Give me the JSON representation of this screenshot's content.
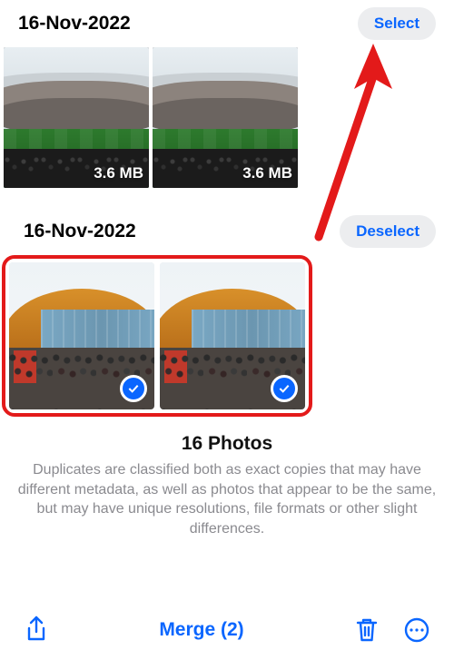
{
  "groups": [
    {
      "date": "16-Nov-2022",
      "action_label": "Select",
      "photos": [
        {
          "size_label": "3.6 MB",
          "selected": false
        },
        {
          "size_label": "3.6 MB",
          "selected": false
        }
      ]
    },
    {
      "date": "16-Nov-2022",
      "action_label": "Deselect",
      "photos": [
        {
          "selected": true
        },
        {
          "selected": true
        }
      ]
    }
  ],
  "summary": {
    "title": "16 Photos",
    "description": "Duplicates are classified both as exact copies that may have different metadata, as well as photos that appear to be the same, but may have unique resolutions, file formats or other slight differences."
  },
  "toolbar": {
    "merge_label": "Merge (2)"
  },
  "colors": {
    "accent": "#0a66ff",
    "annotation": "#e31a1a"
  },
  "annotation": {
    "arrow_target": "select-button"
  }
}
